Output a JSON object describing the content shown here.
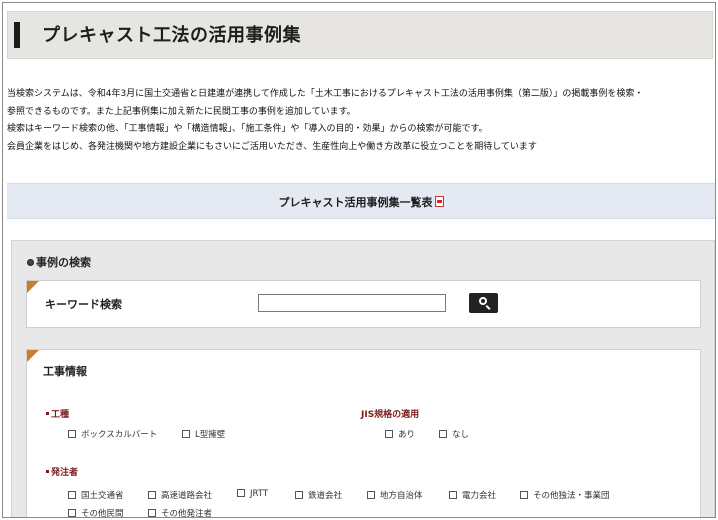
{
  "page": {
    "title": "プレキャスト工法の活用事例集"
  },
  "description": {
    "lines": [
      "当検索システムは、令和4年3月に国土交通省と日建連が連携して作成した「土木工事におけるプレキャスト工法の活用事例集（第二版）」の掲載事例を検索・",
      "参照できるものです。また上記事例集に加え新たに民間工事の事例を追加しています。",
      "検索はキーワード検索の他、「工事情報」や「構造情報」、「施工条件」や「導入の目的・効果」からの検索が可能です。",
      "会員企業をはじめ、各発注機関や地方建設企業にもさいにご活用いただき、生産性向上や働き方改革に役立つことを期待しています"
    ]
  },
  "list_link": {
    "label": "プレキャスト活用事例集一覧表"
  },
  "search": {
    "heading": "事例の検索",
    "keyword": {
      "label": "キーワード検索",
      "value": "",
      "placeholder": ""
    },
    "work_info": {
      "title": "工事情報",
      "kouzou": {
        "label": "工種",
        "options": [
          "ボックスカルバート",
          "L型擁壁"
        ]
      },
      "jis": {
        "label": "JIS規格の適用",
        "options": [
          "あり",
          "なし"
        ]
      },
      "orderer": {
        "label": "発注者",
        "options": [
          "国土交通省",
          "高速道路会社",
          "JRTT",
          "鉄道会社",
          "地方自治体",
          "電力会社",
          "その他独法・事業団",
          "その他民間",
          "その他発注者"
        ]
      }
    }
  },
  "colors": {
    "title_bg": "#e6e5e1",
    "list_bar_bg": "#e5eaf2",
    "search_bg": "#e8e8e8",
    "accent_orange": "#c97b2e",
    "group_label": "#7b1c1c"
  },
  "icons": {
    "list_link": "pdf-icon",
    "search_button": "search-icon",
    "heading": "circle-bullet-icon"
  }
}
